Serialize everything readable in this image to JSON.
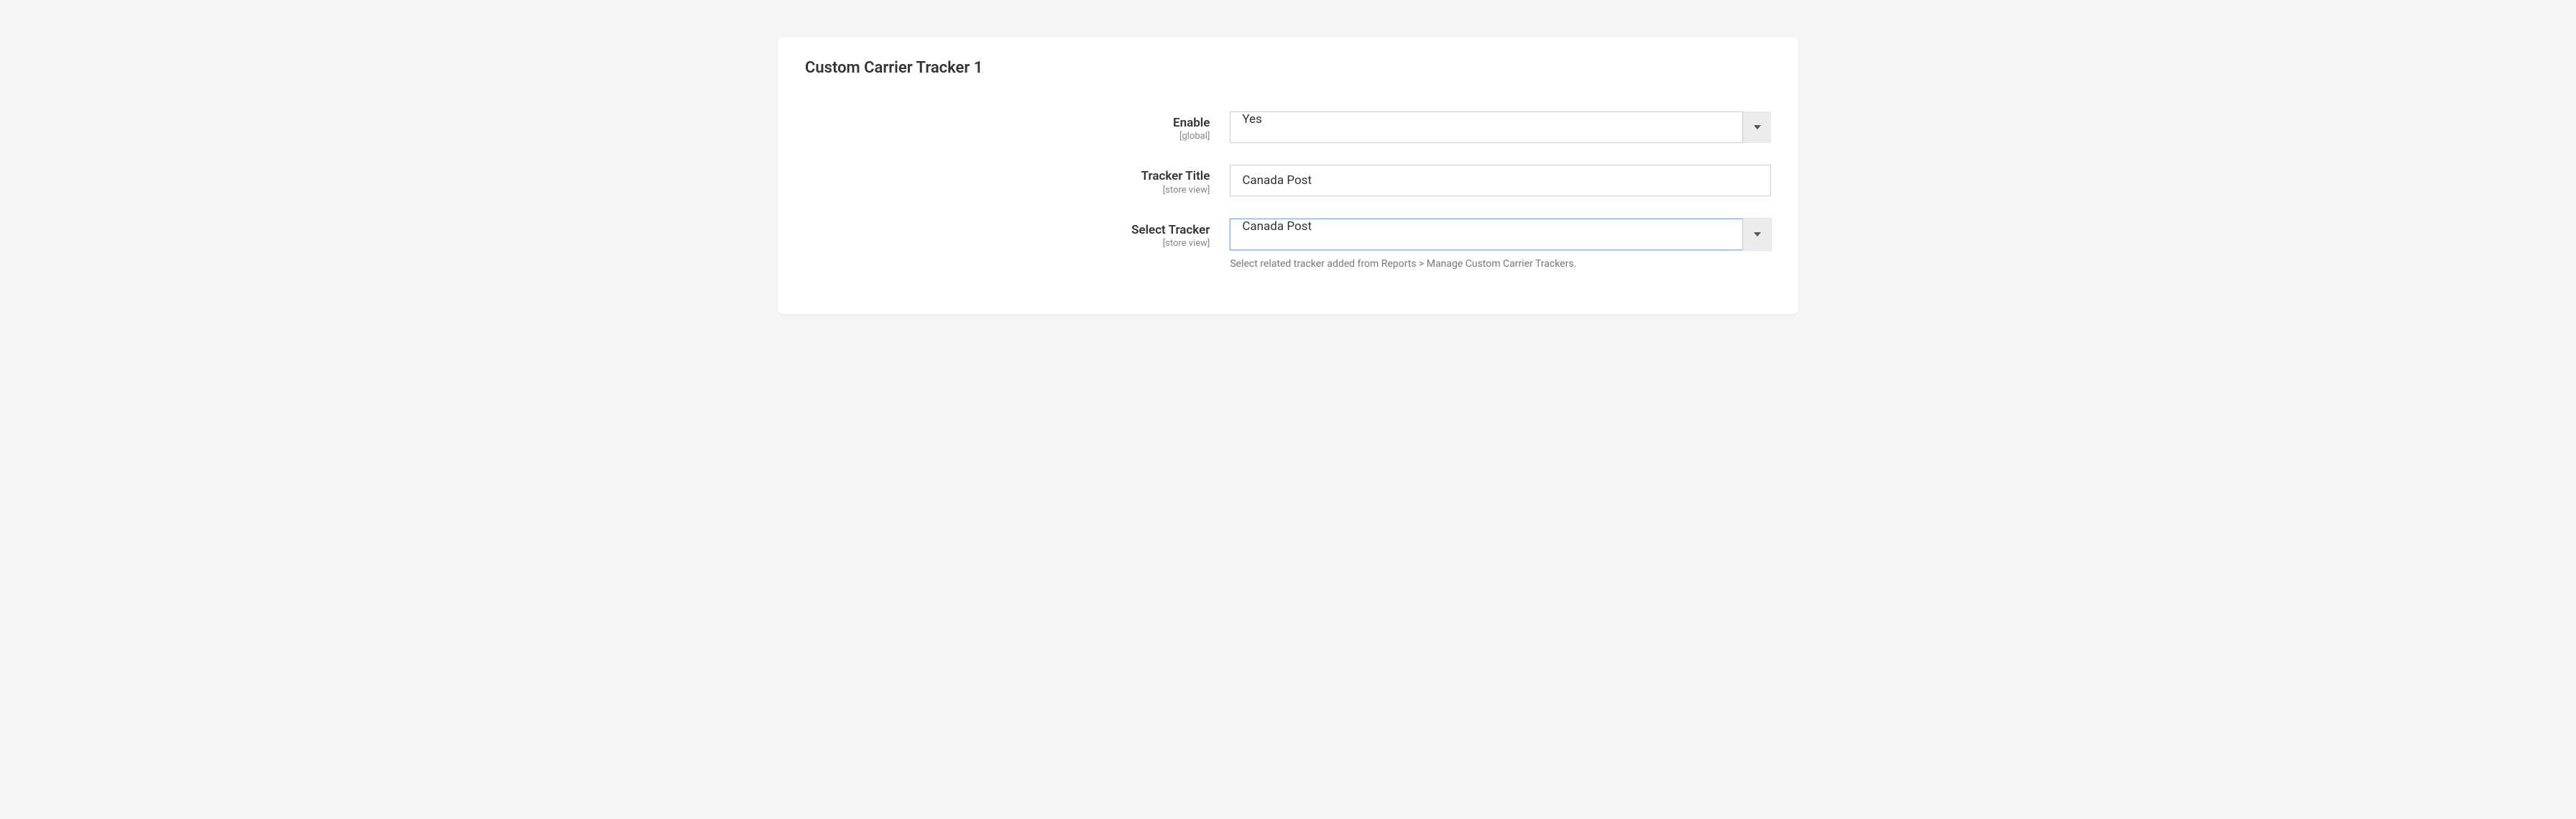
{
  "panel": {
    "title": "Custom Carrier Tracker 1"
  },
  "fields": {
    "enable": {
      "label": "Enable",
      "scope": "[global]",
      "value": "Yes"
    },
    "tracker_title": {
      "label": "Tracker Title",
      "scope": "[store view]",
      "value": "Canada Post"
    },
    "select_tracker": {
      "label": "Select Tracker",
      "scope": "[store view]",
      "value": "Canada Post",
      "help": "Select related tracker added from Reports > Manage Custom Carrier Trackers."
    }
  }
}
